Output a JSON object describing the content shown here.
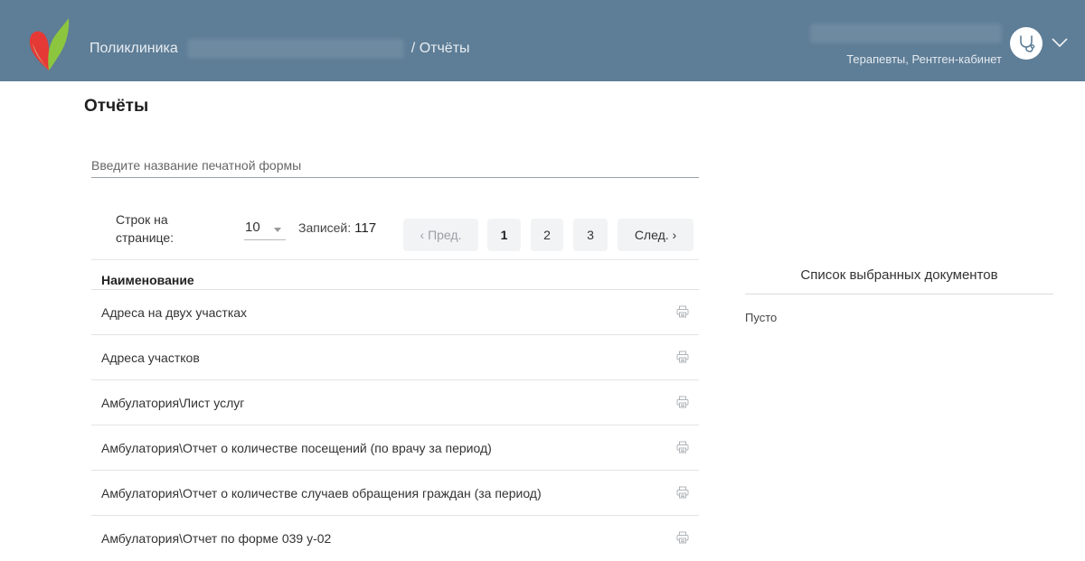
{
  "header": {
    "breadcrumb_start": "Поликлиника",
    "breadcrumb_end": "/ Отчёты",
    "user_role": "Терапевты, Рентген-кабинет",
    "colors": {
      "bar": "#5e7d96",
      "logo_green": "#8cc63f",
      "logo_red": "#e53935"
    }
  },
  "page": {
    "title": "Отчёты",
    "search_placeholder": "Введите название печатной формы"
  },
  "pager": {
    "rows_label_line1": "Строк на",
    "rows_label_line2": "странице:",
    "rows_per_page": "10",
    "records_label": "Записей:",
    "records_count": "117",
    "prev_label": "‹ Пред.",
    "next_label": "След. ›",
    "pages": [
      "1",
      "2",
      "3"
    ],
    "current_page": "1"
  },
  "table": {
    "column_header": "Наименование",
    "rows": [
      "Адреса на двух участках",
      "Адреса участков",
      "Амбулатория\\Лист услуг",
      "Амбулатория\\Отчет о количестве посещений (по врачу за период)",
      "Амбулатория\\Отчет о количестве случаев обращения граждан (за период)",
      "Амбулатория\\Отчет по форме 039 у-02"
    ],
    "row_icon": "printer-icon"
  },
  "selected_docs": {
    "title": "Список выбранных документов",
    "empty_text": "Пусто"
  }
}
